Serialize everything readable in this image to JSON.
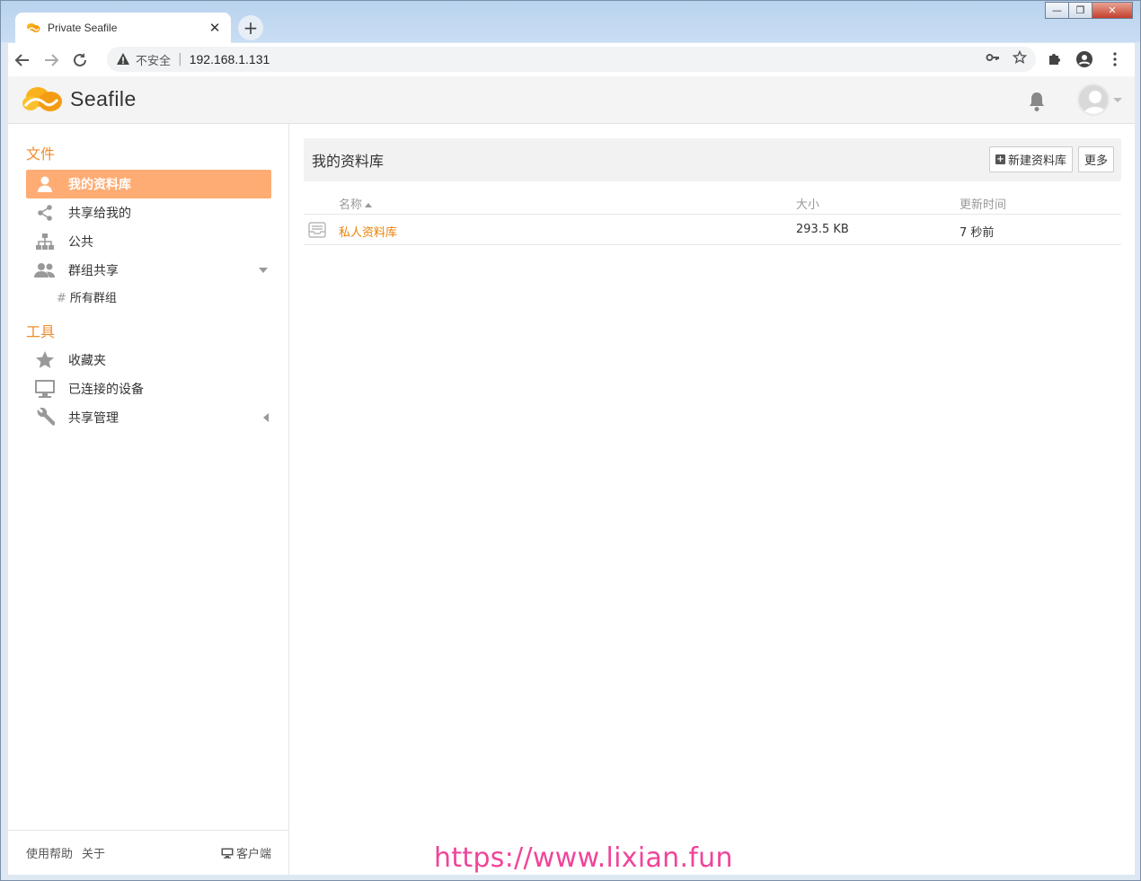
{
  "browser": {
    "tab_title": "Private Seafile",
    "tab_close": "✕",
    "new_tab": "+",
    "insecure_label": "不安全",
    "separator": "|",
    "url": "192.168.1.131",
    "window_minimize": "—",
    "window_restore": "❐",
    "window_close": "✕"
  },
  "header": {
    "brand": "Seafile"
  },
  "sidebar": {
    "files_heading": "文件",
    "items": [
      {
        "label": "我的资料库",
        "icon": "user-icon",
        "active": true
      },
      {
        "label": "共享给我的",
        "icon": "share-icon"
      },
      {
        "label": "公共",
        "icon": "org-chart-icon"
      },
      {
        "label": "群组共享",
        "icon": "group-icon"
      }
    ],
    "sub_item": {
      "hash": "#",
      "label": "所有群组"
    },
    "tools_heading": "工具",
    "tools": [
      {
        "label": "收藏夹",
        "icon": "star-icon"
      },
      {
        "label": "已连接的设备",
        "icon": "monitor-icon"
      },
      {
        "label": "共享管理",
        "icon": "wrench-icon"
      }
    ],
    "footer": {
      "help": "使用帮助",
      "about": "关于",
      "client": "客户端"
    }
  },
  "main": {
    "title": "我的资料库",
    "new_library_button": "新建资料库",
    "more_button": "更多",
    "columns": {
      "name": "名称",
      "size": "大小",
      "updated": "更新时间"
    },
    "rows": [
      {
        "name": "私人资料库",
        "size": "293.5 KB",
        "updated": "7 秒前"
      }
    ]
  },
  "watermark": "https://www.lixian.fun",
  "colors": {
    "accent": "#f28b2c",
    "active_bg": "#feac74",
    "link": "#eb8205",
    "watermark": "#f0449a"
  }
}
